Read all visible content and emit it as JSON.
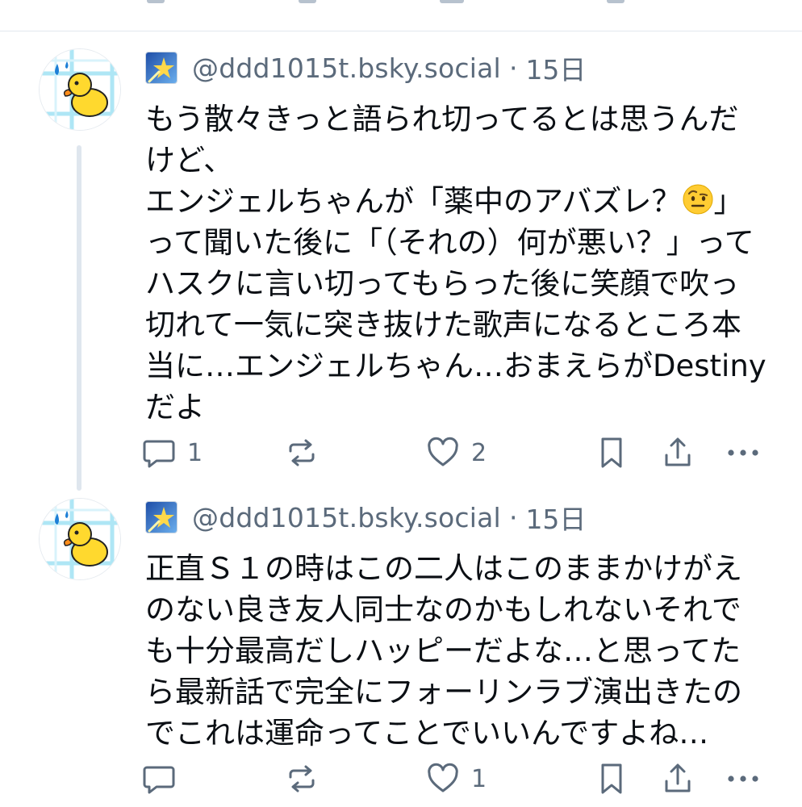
{
  "posts": [
    {
      "handle": "@ddd1015t.bsky.social",
      "separator": "·",
      "time": "15日",
      "text_before_emoji": "もう散々きっと語られ切ってるとは思うんだけど、\nエンジェルちゃんが「薬中のアバズレ？",
      "emoji": "raised-eyebrow-face",
      "text_after_emoji": "」って聞いた後に「（それの）何が悪い？」ってハスクに言い切ってもらった後に笑顔で吹っ切れて一気に突き抜けた歌声になるところ本当に…エンジェルちゃん…おまえらがDestinyだよ",
      "reply_count": "1",
      "repost_count": "",
      "like_count": "2"
    },
    {
      "handle": "@ddd1015t.bsky.social",
      "separator": "·",
      "time": "15日",
      "text": "正直Ｓ１の時はこの二人はこのままかけがえのない良き友人同士なのかもしれないそれでも十分最高だしハッピーだよな…と思ってたら最新話で完全にフォーリンラブ演出きたのでこれは運命ってことでいいんですよね…",
      "reply_count": "",
      "repost_count": "",
      "like_count": "1"
    }
  ],
  "colors": {
    "muted": "#5b6a7b",
    "text": "#0b0f14",
    "divider": "#e3e8ee",
    "thread_line": "#dfe6ee"
  }
}
